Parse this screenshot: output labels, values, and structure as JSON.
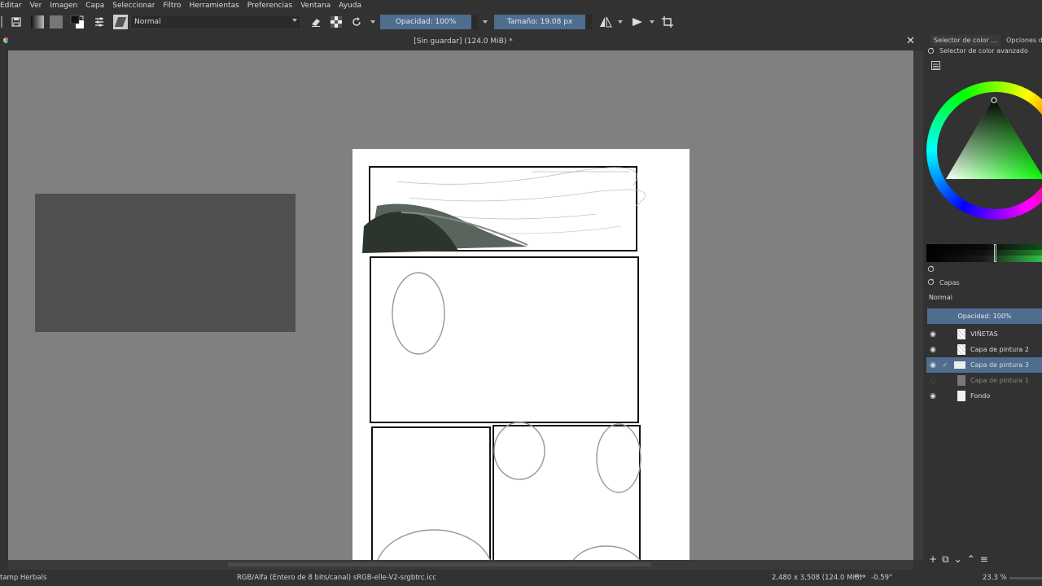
{
  "menu": [
    "Editar",
    "Ver",
    "Imagen",
    "Capa",
    "Seleccionar",
    "Filtro",
    "Herramientas",
    "Preferencias",
    "Ventana",
    "Ayuda"
  ],
  "toolbar": {
    "blend_mode": "Normal",
    "opacity": "Opacidad: 100%",
    "size": "Tamaño: 19.08 px"
  },
  "document": {
    "title": "[Sin guardar]  (124.0 MiB) *"
  },
  "dock": {
    "tab_color_selector": "Selector de color ...",
    "tab_tool_options": "Opciones de",
    "advanced_selector_label": "Selector de color avanzado",
    "layers_title": "Capas",
    "layers_blend": "Normal",
    "layers_opacity": "Opacidad:  100%",
    "layers": [
      {
        "name": "VIÑETAS",
        "visible": true,
        "selected": false
      },
      {
        "name": "Capa de pintura 2",
        "visible": true,
        "selected": false
      },
      {
        "name": "Capa de pintura 3",
        "visible": true,
        "selected": true
      },
      {
        "name": "Capa de pintura 1",
        "visible": false,
        "selected": false
      },
      {
        "name": "Fondo",
        "visible": true,
        "selected": false
      }
    ]
  },
  "status": {
    "brush": "tamp Herbals",
    "color_space": "RGB/Alfa (Entero de 8 bits/canal)  sRGB-elle-V2-srgbtrc.icc",
    "dimensions": "2,480 x 3,508 (124.0 MiB)",
    "rotation": "-0.59°",
    "zoom": "23.3 %"
  },
  "colors": {
    "accent": "#4e6d8f",
    "canvas_bg": "#808080",
    "ui_bg": "#323232"
  }
}
